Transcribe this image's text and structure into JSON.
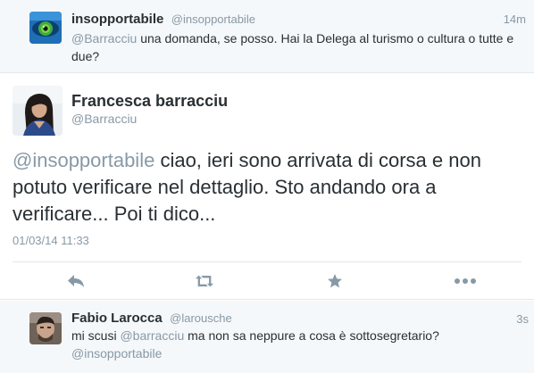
{
  "tweet_top": {
    "fullname": "insopportabile",
    "handle": "@insopportabile",
    "time": "14m",
    "mention": "@Barracciu",
    "text": " una domanda,  se posso.  Hai la Delega al turismo o cultura o tutte e due?"
  },
  "main_tweet": {
    "fullname": "Francesca barracciu",
    "handle": "@Barracciu",
    "mention": "@insopportabile",
    "text": " ciao, ieri sono arrivata di corsa e non potuto verificare nel dettaglio. Sto andando ora a verificare... Poi ti dico...",
    "date": "01/03/14 11:33",
    "actions": [
      {
        "name": "reply",
        "icon": "reply-icon"
      },
      {
        "name": "retweet",
        "icon": "retweet-icon"
      },
      {
        "name": "favorite",
        "icon": "star-icon"
      },
      {
        "name": "more",
        "icon": "more-icon"
      }
    ]
  },
  "reply_tweet": {
    "fullname": "Fabio Larocca",
    "handle": "@larousche",
    "time": "3s",
    "text_before": "mi scusi ",
    "mention": "@barracciu",
    "text_after": " ma non sa neppure a cosa è sottosegretario?",
    "mention2": "@insopportabile"
  },
  "colors": {
    "text": "#292f33",
    "muted": "#8899a6",
    "panel_bg": "#f5f8fa",
    "border": "#e1e8ed"
  }
}
